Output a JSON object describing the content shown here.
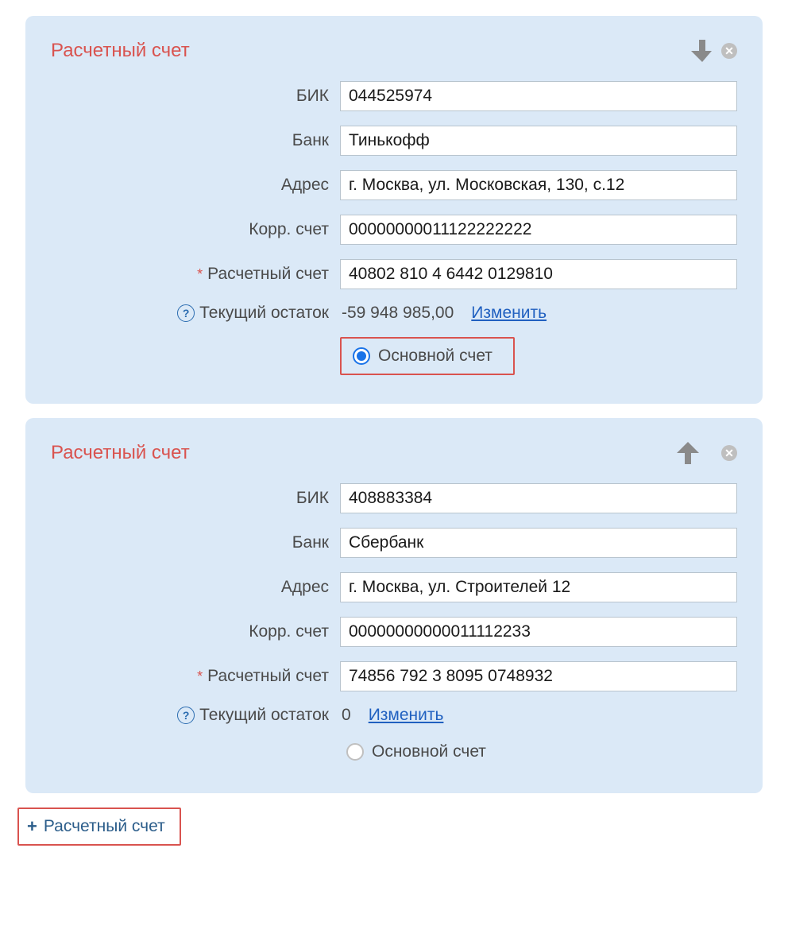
{
  "labels": {
    "card_title": "Расчетный счет",
    "bik": "БИК",
    "bank": "Банк",
    "address": "Адрес",
    "corr": "Корр. счет",
    "account": "Расчетный счет",
    "balance": "Текущий остаток",
    "change": "Изменить",
    "main_account": "Основной счет",
    "add_account": "Расчетный счет"
  },
  "accounts": [
    {
      "bik": "044525974",
      "bank": "Тинькофф",
      "address": "г. Москва, ул. Московская, 130, с.12",
      "corr": "00000000011122222222",
      "account": "40802 810 4 6442 0129810",
      "balance": "-59 948 985,00",
      "is_main": true
    },
    {
      "bik": "408883384",
      "bank": "Сбербанк",
      "address": "г. Москва, ул. Строителей 12",
      "corr": "00000000000011112233",
      "account": "74856 792 3 8095 0748932",
      "balance": "0",
      "is_main": false
    }
  ]
}
